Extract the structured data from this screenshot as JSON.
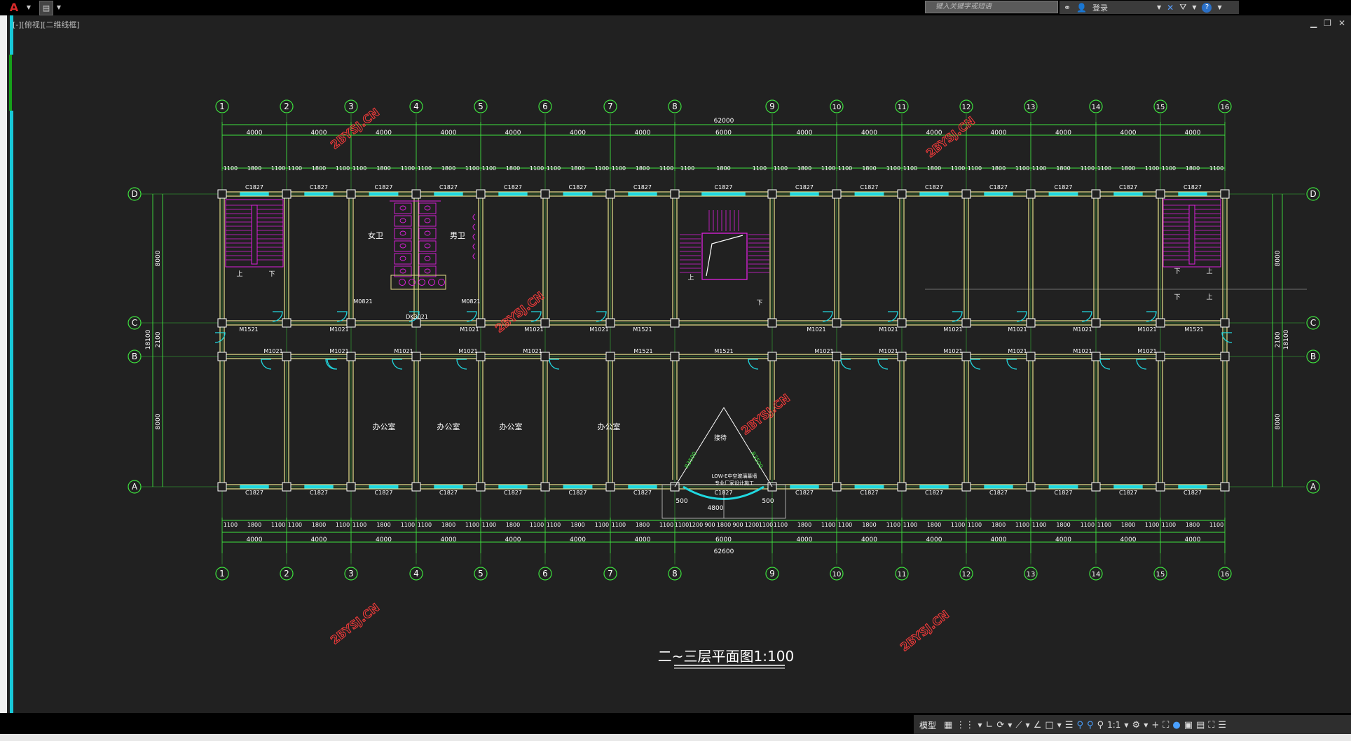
{
  "titlebar": {
    "logo": "A",
    "search_placeholder": "键入关键字或短语",
    "login": "登录"
  },
  "viewport_label": "[-][俯视][二维线框]",
  "drawing": {
    "title": "二~三层平面图1:100",
    "watermark": "2BYSJ.CN",
    "axes": [
      "1",
      "2",
      "3",
      "4",
      "5",
      "6",
      "7",
      "8",
      "9",
      "10",
      "11",
      "12",
      "13",
      "14",
      "15",
      "16"
    ],
    "rows": [
      "A",
      "B",
      "C",
      "D"
    ],
    "overall_top": "62000",
    "overall_bottom": "62600",
    "bay_dims": [
      "4000",
      "4000",
      "4000",
      "4000",
      "4000",
      "4000",
      "4000",
      "6000",
      "4000",
      "4000",
      "4000",
      "4000",
      "4000",
      "4000",
      "4000"
    ],
    "left_dims": {
      "total": "18100",
      "d_c": "8000",
      "c_b": "2100",
      "b_a": "8000"
    },
    "window_label": "C1827",
    "door_m1021": "M1021",
    "door_m1521": "M1521",
    "door_m0821": "M0821",
    "dk_label": "DK3021",
    "room_labels": {
      "nv_wei": "女卫",
      "nan_wei": "男卫",
      "office": "办公室",
      "reception": "接待"
    },
    "stair_up": "上",
    "stair_down": "下",
    "entrance_dims": [
      "500",
      "4800",
      "500"
    ],
    "entrance_bottom": [
      "1100",
      "1200",
      "900",
      "1800",
      "900",
      "1200",
      "1100"
    ],
    "arc_label": "R3500",
    "company_text": [
      "LOW-E中空玻璃幕墙",
      "专业厂家设计施工"
    ]
  },
  "statusbar": {
    "model": "模型",
    "scale": "1:1"
  }
}
